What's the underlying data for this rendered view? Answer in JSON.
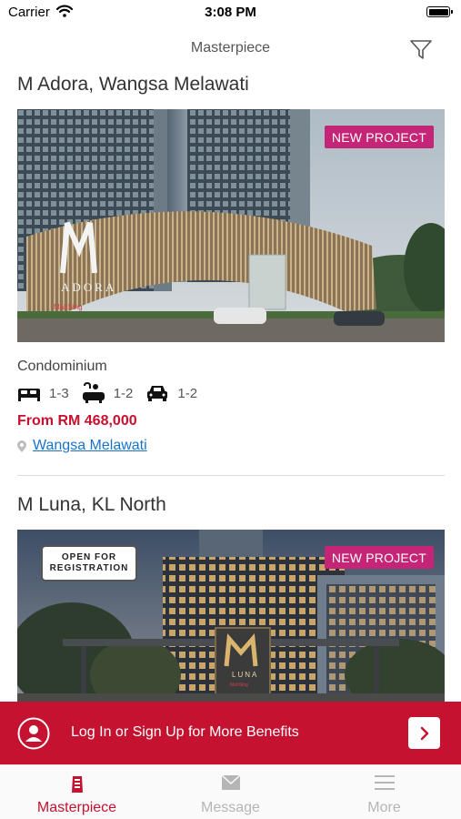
{
  "status_bar": {
    "carrier": "Carrier",
    "time": "3:08 PM",
    "battery_level": 1.0
  },
  "nav": {
    "title": "Masterpiece",
    "filter_icon": "filter-icon"
  },
  "listings": [
    {
      "title": "M Adora, Wangsa Melawati",
      "badge": "NEW PROJECT",
      "image_sign": "ADORA",
      "image_brand": "MahSing",
      "type": "Condominium",
      "bedrooms": "1-3",
      "bathrooms": "1-2",
      "parking": "1-2",
      "price": "From RM 468,000",
      "location": "Wangsa Melawati"
    },
    {
      "title": "M Luna, KL North",
      "badge": "NEW PROJECT",
      "registration_badge": [
        "OPEN FOR",
        "REGISTRATION"
      ],
      "image_sign": "LUNA",
      "image_brand": "MahSing"
    }
  ],
  "login_banner": {
    "text": "Log In or Sign Up for More Benefits"
  },
  "tabs": [
    {
      "label": "Masterpiece",
      "icon": "building-icon",
      "active": true
    },
    {
      "label": "Message",
      "icon": "envelope-icon",
      "active": false
    },
    {
      "label": "More",
      "icon": "menu-icon",
      "active": false
    }
  ],
  "colors": {
    "brand_red": "#c41230",
    "badge_magenta": "#c42576",
    "link_blue": "#1a73c8"
  }
}
